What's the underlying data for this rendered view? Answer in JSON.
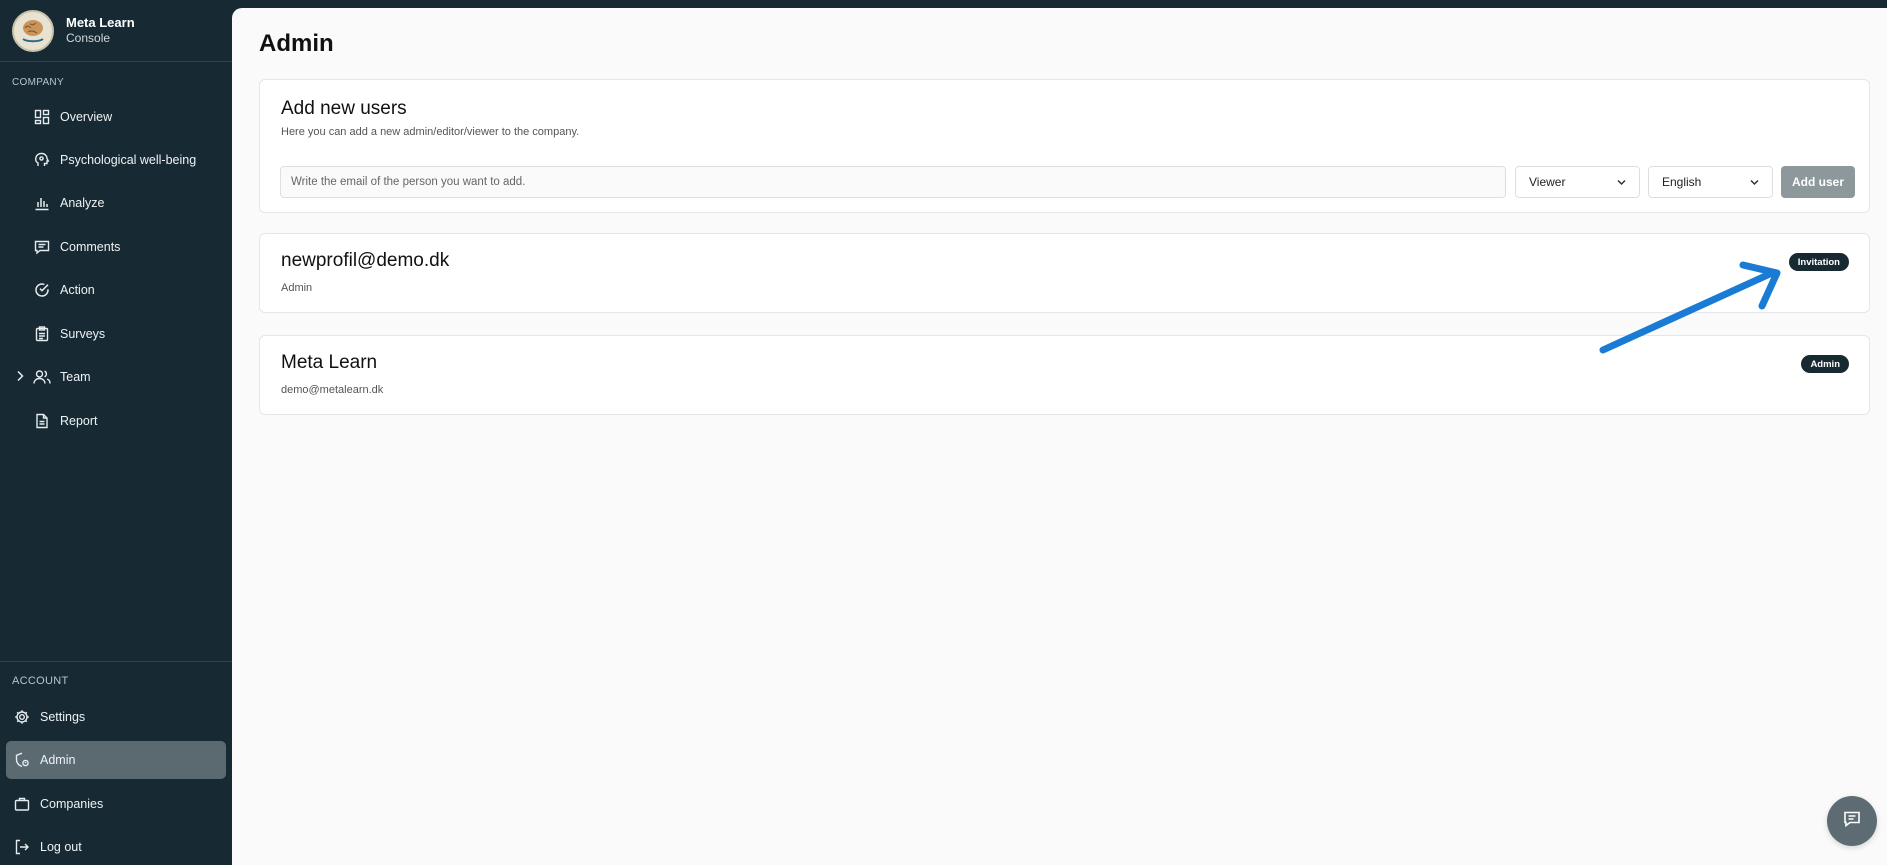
{
  "brand": {
    "name": "Meta Learn",
    "subtitle": "Console"
  },
  "sidebar": {
    "company_label": "COMPANY",
    "company_items": [
      {
        "label": "Overview",
        "icon": "grid-icon"
      },
      {
        "label": "Psychological well-being",
        "icon": "brain-head-icon"
      },
      {
        "label": "Analyze",
        "icon": "bar-chart-icon"
      },
      {
        "label": "Comments",
        "icon": "comment-icon"
      },
      {
        "label": "Action",
        "icon": "check-circle-icon"
      },
      {
        "label": "Surveys",
        "icon": "clipboard-icon"
      },
      {
        "label": "Team",
        "icon": "users-icon"
      },
      {
        "label": "Report",
        "icon": "document-icon"
      }
    ],
    "account_label": "ACCOUNT",
    "account_items": [
      {
        "label": "Settings",
        "icon": "gear-icon"
      },
      {
        "label": "Admin",
        "icon": "shield-icon"
      },
      {
        "label": "Companies",
        "icon": "briefcase-icon"
      },
      {
        "label": "Log out",
        "icon": "logout-icon"
      }
    ],
    "active_item": "Admin"
  },
  "page": {
    "title": "Admin"
  },
  "add_users": {
    "title": "Add new users",
    "description": "Here you can add a new admin/editor/viewer to the company.",
    "email_placeholder": "Write the email of the person you want to add.",
    "role_value": "Viewer",
    "language_value": "English",
    "add_button": "Add user"
  },
  "users": [
    {
      "title": "newprofil@demo.dk",
      "subtitle": "Admin",
      "badge": "Invitation"
    },
    {
      "title": "Meta Learn",
      "subtitle": "demo@metalearn.dk",
      "badge": "Admin"
    }
  ],
  "colors": {
    "sidebar_bg": "#172a33",
    "active_bg": "#5b6a71",
    "badge_bg": "#182a31",
    "button_bg": "#8d989d",
    "arrow": "#1a7bd4"
  }
}
